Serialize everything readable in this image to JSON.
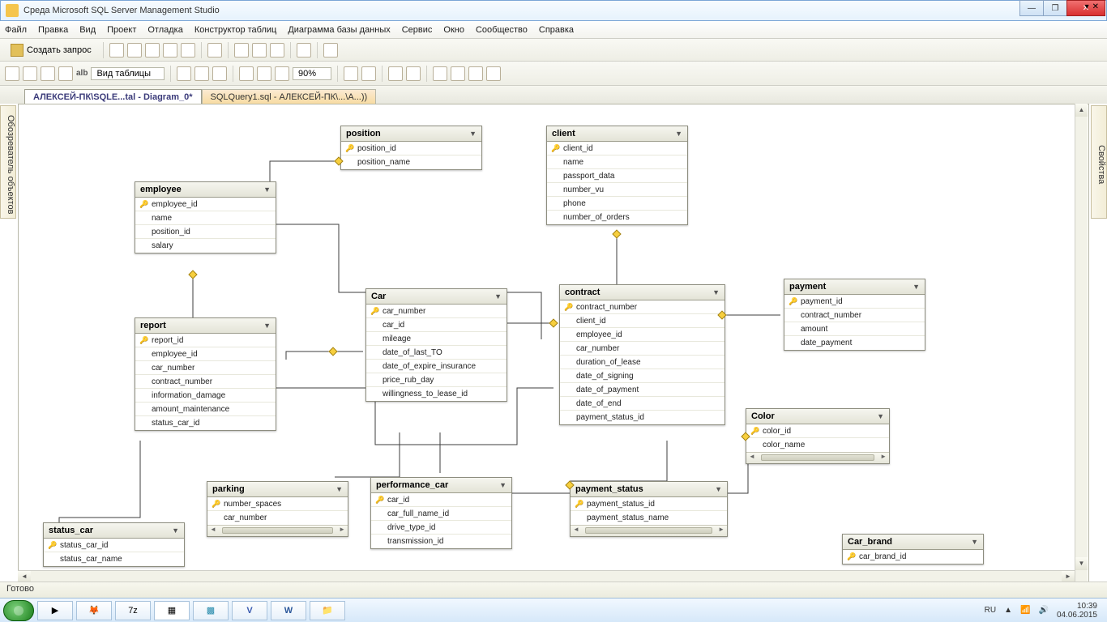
{
  "window": {
    "title": "Среда Microsoft SQL Server Management Studio"
  },
  "menu": [
    "Файл",
    "Правка",
    "Вид",
    "Проект",
    "Отладка",
    "Конструктор таблиц",
    "Диаграмма базы данных",
    "Сервис",
    "Окно",
    "Сообщество",
    "Справка"
  ],
  "toolbar": {
    "new_query": "Создать запрос",
    "view_tables": "Вид таблицы",
    "zoom": "90%"
  },
  "tabs": {
    "active": "АЛЕКСЕЙ-ПК\\SQLE...tal - Diagram_0*",
    "inactive": "SQLQuery1.sql - АЛЕКСЕЙ-ПК\\...\\A...))"
  },
  "side_left": "Обозреватель объектов",
  "side_right": "Свойства",
  "status": "Готово",
  "tray": {
    "lang": "RU",
    "time": "10:39",
    "date": "04.06.2015"
  },
  "tables": {
    "employee": {
      "title": "employee",
      "cols": [
        {
          "k": 1,
          "n": "employee_id"
        },
        {
          "k": 0,
          "n": "name"
        },
        {
          "k": 0,
          "n": "position_id"
        },
        {
          "k": 0,
          "n": "salary"
        }
      ]
    },
    "position": {
      "title": "position",
      "cols": [
        {
          "k": 1,
          "n": "position_id"
        },
        {
          "k": 0,
          "n": "position_name"
        }
      ]
    },
    "client": {
      "title": "client",
      "cols": [
        {
          "k": 1,
          "n": "client_id"
        },
        {
          "k": 0,
          "n": "name"
        },
        {
          "k": 0,
          "n": "passport_data"
        },
        {
          "k": 0,
          "n": "number_vu"
        },
        {
          "k": 0,
          "n": "phone"
        },
        {
          "k": 0,
          "n": "number_of_orders"
        }
      ]
    },
    "report": {
      "title": "report",
      "cols": [
        {
          "k": 1,
          "n": "report_id"
        },
        {
          "k": 0,
          "n": "employee_id"
        },
        {
          "k": 0,
          "n": "car_number"
        },
        {
          "k": 0,
          "n": "contract_number"
        },
        {
          "k": 0,
          "n": "information_damage"
        },
        {
          "k": 0,
          "n": "amount_maintenance"
        },
        {
          "k": 0,
          "n": "status_car_id"
        }
      ]
    },
    "car": {
      "title": "Car",
      "cols": [
        {
          "k": 1,
          "n": "car_number"
        },
        {
          "k": 0,
          "n": "car_id"
        },
        {
          "k": 0,
          "n": "mileage"
        },
        {
          "k": 0,
          "n": "date_of_last_TO"
        },
        {
          "k": 0,
          "n": "date_of_expire_insurance"
        },
        {
          "k": 0,
          "n": "price_rub_day"
        },
        {
          "k": 0,
          "n": "willingness_to_lease_id"
        }
      ]
    },
    "contract": {
      "title": "contract",
      "cols": [
        {
          "k": 1,
          "n": "contract_number"
        },
        {
          "k": 0,
          "n": "client_id"
        },
        {
          "k": 0,
          "n": "employee_id"
        },
        {
          "k": 0,
          "n": "car_number"
        },
        {
          "k": 0,
          "n": "duration_of_lease"
        },
        {
          "k": 0,
          "n": "date_of_signing"
        },
        {
          "k": 0,
          "n": "date_of_payment"
        },
        {
          "k": 0,
          "n": "date_of_end"
        },
        {
          "k": 0,
          "n": "payment_status_id"
        }
      ]
    },
    "payment": {
      "title": "payment",
      "cols": [
        {
          "k": 1,
          "n": "payment_id"
        },
        {
          "k": 0,
          "n": "contract_number"
        },
        {
          "k": 0,
          "n": "amount"
        },
        {
          "k": 0,
          "n": "date_payment"
        }
      ]
    },
    "color": {
      "title": "Color",
      "cols": [
        {
          "k": 1,
          "n": "color_id"
        },
        {
          "k": 0,
          "n": "color_name"
        }
      ]
    },
    "parking": {
      "title": "parking",
      "cols": [
        {
          "k": 1,
          "n": "number_spaces"
        },
        {
          "k": 0,
          "n": "car_number"
        }
      ]
    },
    "performance_car": {
      "title": "performance_car",
      "cols": [
        {
          "k": 1,
          "n": "car_id"
        },
        {
          "k": 0,
          "n": "car_full_name_id"
        },
        {
          "k": 0,
          "n": "drive_type_id"
        },
        {
          "k": 0,
          "n": "transmission_id"
        }
      ]
    },
    "payment_status": {
      "title": "payment_status",
      "cols": [
        {
          "k": 1,
          "n": "payment_status_id"
        },
        {
          "k": 0,
          "n": "payment_status_name"
        }
      ]
    },
    "status_car": {
      "title": "status_car",
      "cols": [
        {
          "k": 1,
          "n": "status_car_id"
        },
        {
          "k": 0,
          "n": "status_car_name"
        }
      ]
    },
    "car_brand": {
      "title": "Car_brand",
      "cols": [
        {
          "k": 1,
          "n": "car_brand_id"
        }
      ]
    }
  }
}
